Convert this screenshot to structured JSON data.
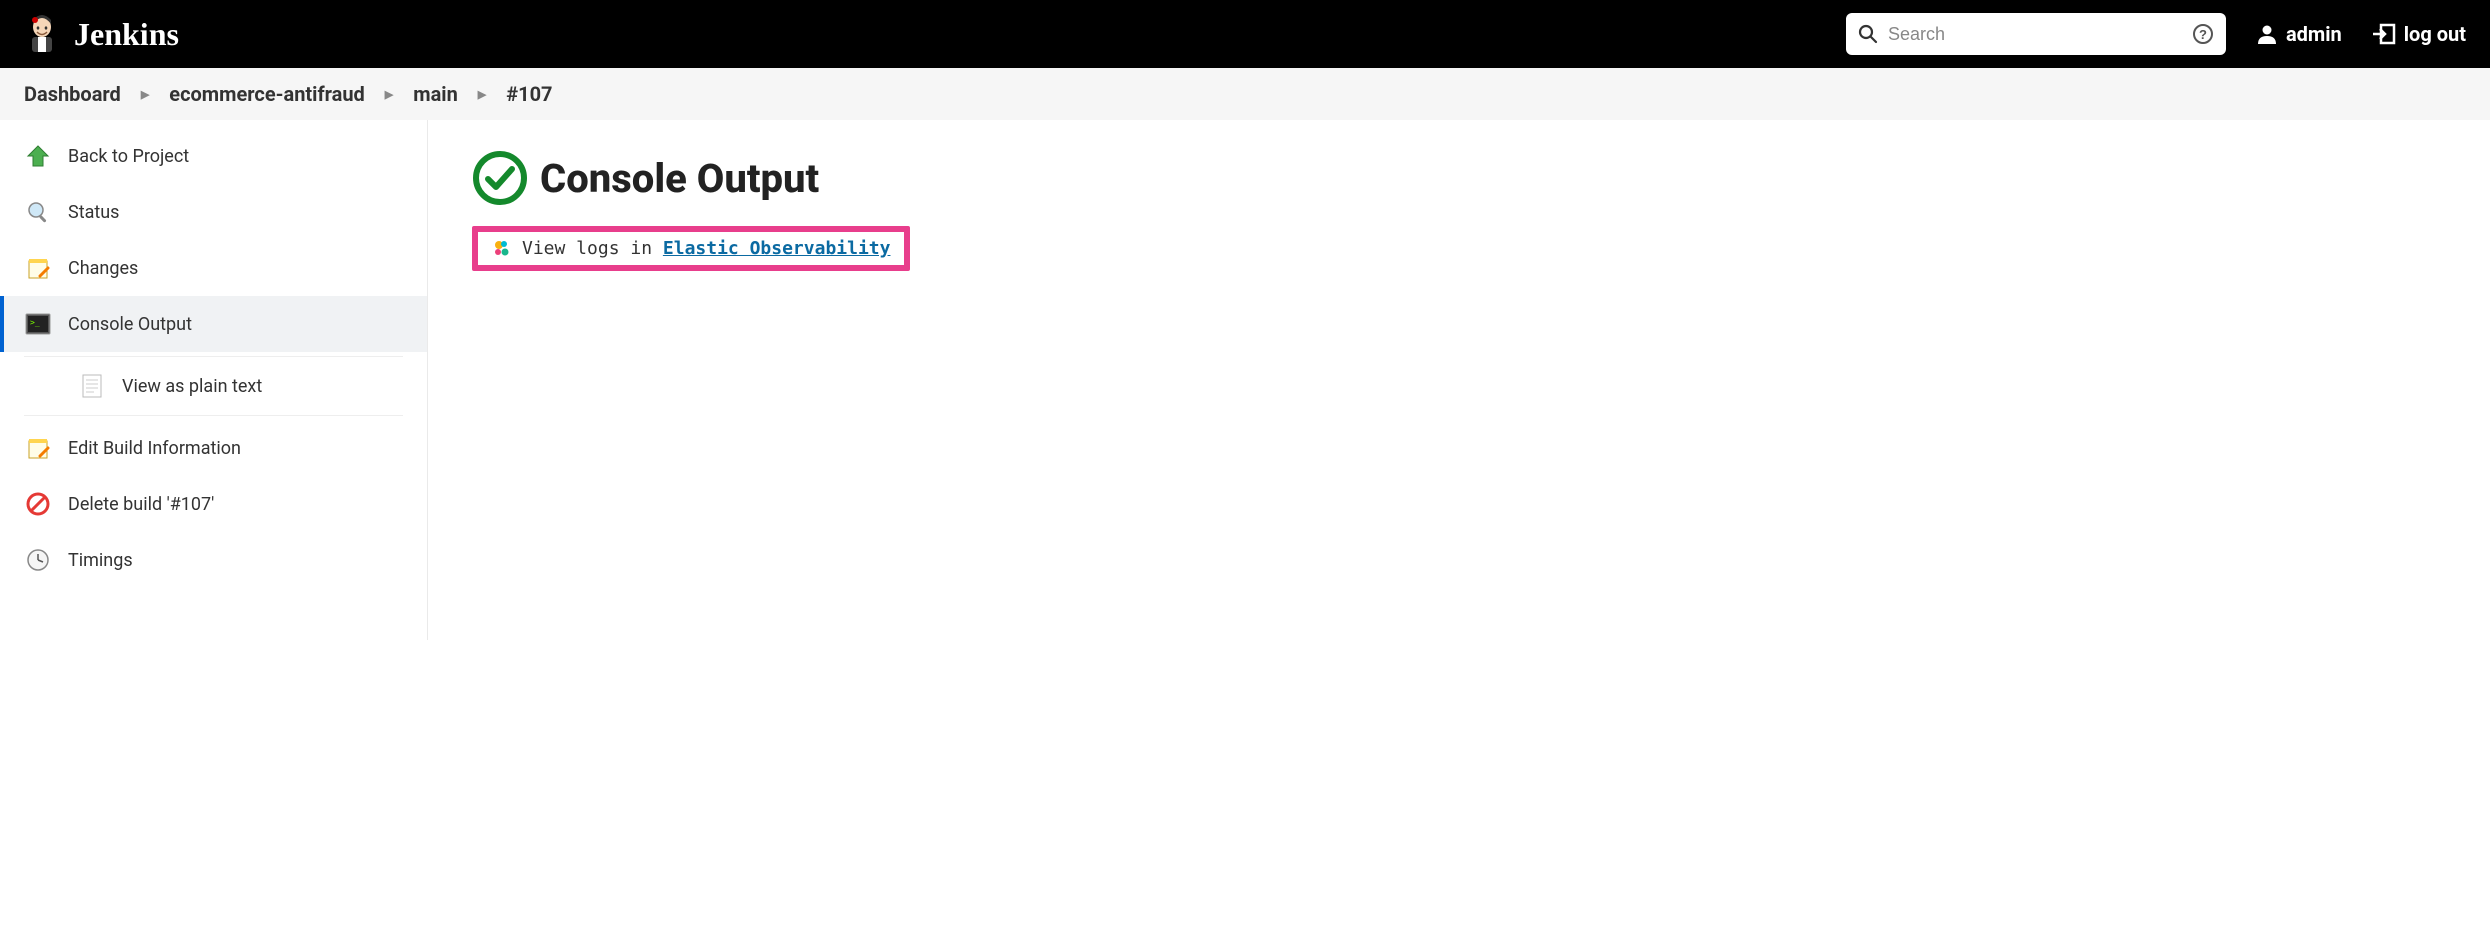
{
  "header": {
    "brand": "Jenkins",
    "search_placeholder": "Search",
    "user": "admin",
    "logout": "log out"
  },
  "breadcrumbs": {
    "items": [
      "Dashboard",
      "ecommerce-antifraud",
      "main",
      "#107"
    ]
  },
  "sidebar": {
    "items": [
      {
        "label": "Back to Project"
      },
      {
        "label": "Status"
      },
      {
        "label": "Changes"
      },
      {
        "label": "Console Output"
      },
      {
        "label": "View as plain text"
      },
      {
        "label": "Edit Build Information"
      },
      {
        "label": "Delete build '#107'"
      },
      {
        "label": "Timings"
      }
    ]
  },
  "main": {
    "title": "Console Output",
    "callout_prefix": "View logs in ",
    "callout_link": "Elastic Observability"
  }
}
